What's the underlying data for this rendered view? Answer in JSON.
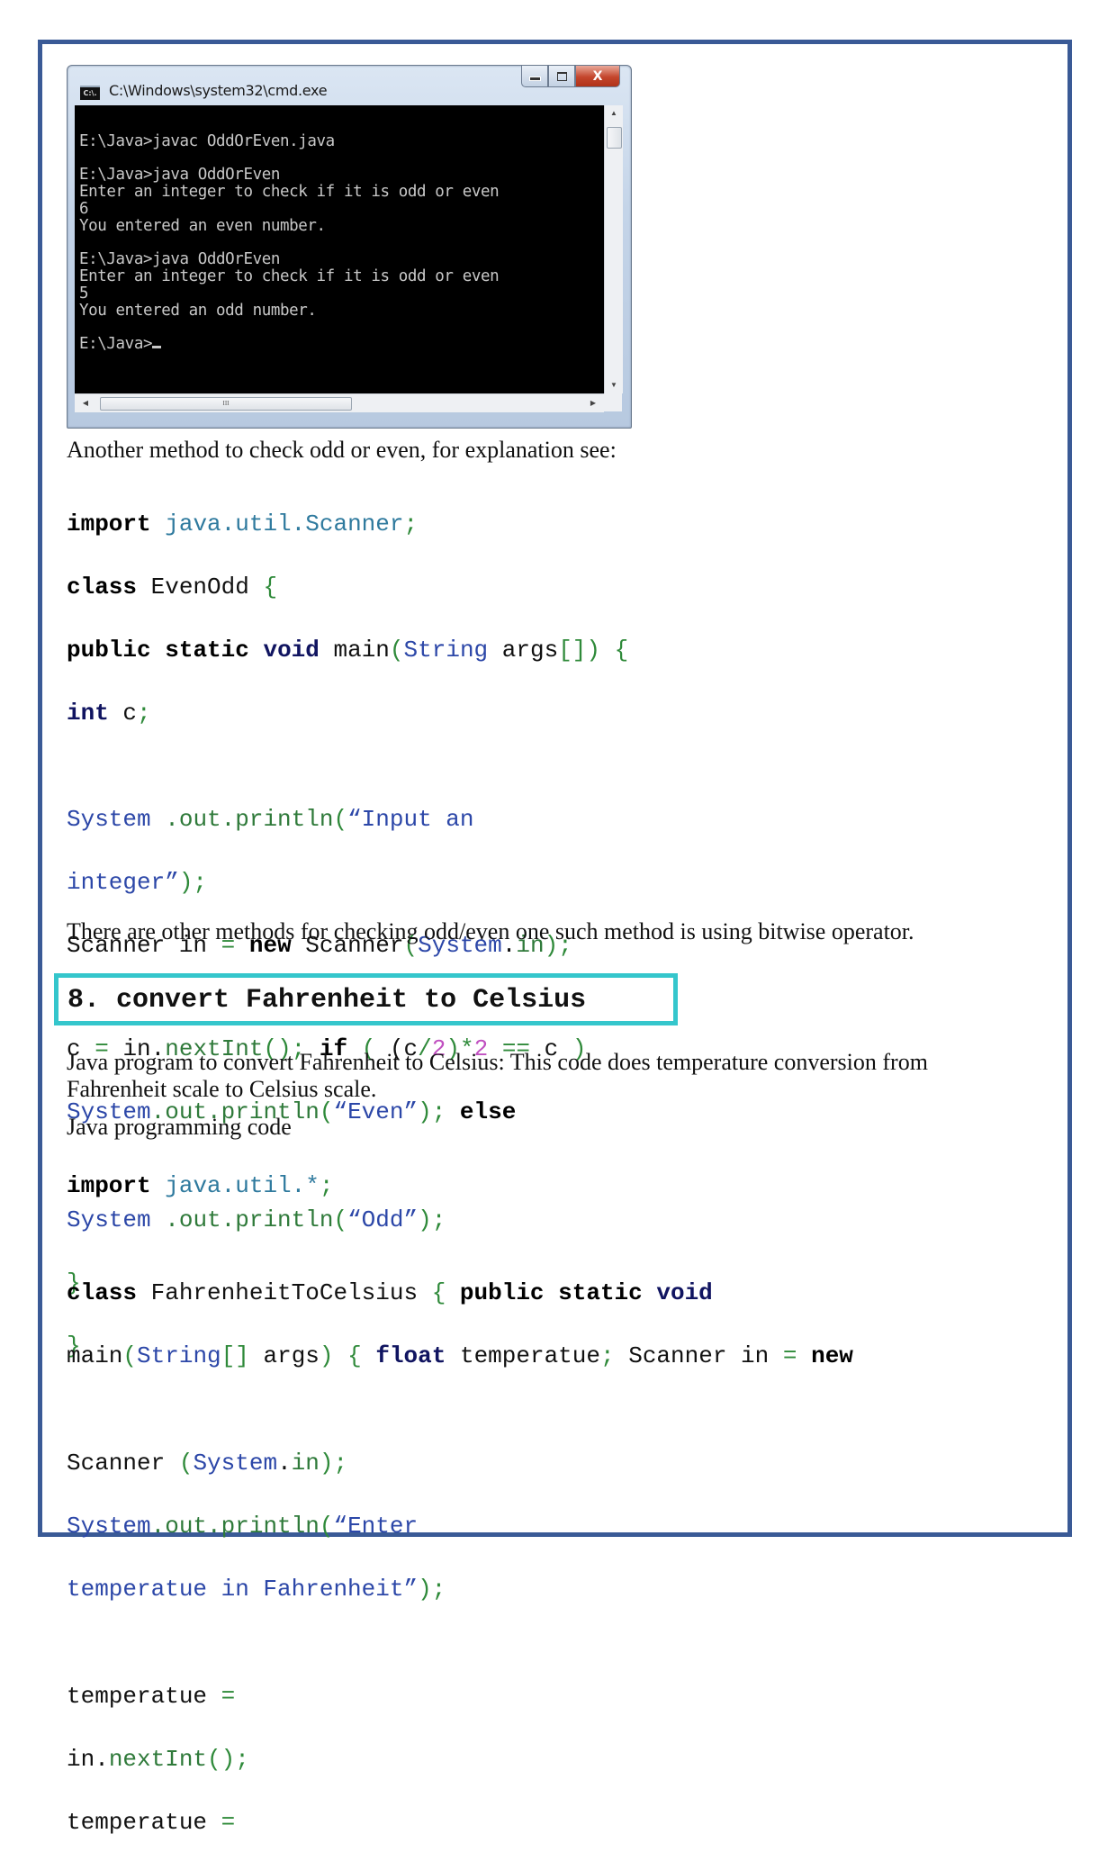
{
  "cmd_window": {
    "title": "C:\\Windows\\system32\\cmd.exe",
    "icon_label": "C:\\.",
    "buttons": {
      "minimize": "minimize",
      "maximize": "maximize",
      "close": "X"
    },
    "console_lines": [
      "",
      "E:\\Java>javac OddOrEven.java",
      "",
      "E:\\Java>java OddOrEven",
      "Enter an integer to check if it is odd or even",
      "6",
      "You entered an even number.",
      "",
      "E:\\Java>java OddOrEven",
      "Enter an integer to check if it is odd or even",
      "5",
      "You entered an odd number.",
      "",
      "E:\\Java>"
    ],
    "scrollbar_thumb_grip": "III"
  },
  "intro_text": "Another method to check odd or even, for explanation see:",
  "code1": {
    "l1": {
      "kw": "import",
      "pkg": "java.util.Scanner",
      "semi": ";"
    },
    "l2": {
      "kw": "class",
      "name": "EvenOdd",
      "brace": "{"
    },
    "l3": {
      "kw1": "public",
      "kw2": "static",
      "kw3": "void",
      "name": "main",
      "open": "(",
      "type": "String",
      "args": "args",
      "brackets": "[])",
      "brace": "{"
    },
    "l4": {
      "kw": "int",
      "var": "c",
      "semi": ";"
    },
    "l5": {
      "cls": "System",
      "dotout": ".out.println",
      "open": "(",
      "str": "“Input an"
    },
    "l6": {
      "str": "integer”",
      "close": ");"
    },
    "l7": {
      "type": "Scanner",
      "var": "in",
      "eq": "=",
      "kw": "new",
      "ctor": "Scanner",
      "open": "(",
      "cls": "System",
      "dot": ".",
      "field": "in",
      "close": ");"
    },
    "l8": {
      "var": "c",
      "eq": "=",
      "obj": "in.",
      "meth": "nextInt",
      "call": "();",
      "kw": "if",
      "open": "(",
      "p2": "(c",
      "slash": "/",
      "two": "2",
      "p3": ")*",
      "two2": "2",
      "eqeq": "==",
      "c": "c",
      "close": ")"
    },
    "l9": {
      "cls": "System",
      "dotout": ".out.println",
      "open": "(",
      "str": "“Even”",
      "close": ");",
      "kw": "else"
    },
    "l10": {
      "cls": "System",
      "dotout": ".out.println",
      "open": "(",
      "str": "“Odd”",
      "close": ");"
    },
    "l11": "}",
    "l12": "}"
  },
  "other_methods_text": "There are other methods for checking odd/even one such method is using bitwise operator.",
  "section": {
    "title": "8. convert Fahrenheit to Celsius"
  },
  "f2c_description": "Java program to convert Fahrenheit to Celsius: This code does temperature conversion from Fahrenheit scale to Celsius scale.",
  "code_label": "Java programming code",
  "code2": {
    "l1": {
      "kw": "import",
      "pkg": "java.util.*",
      "semi": ";"
    },
    "l2": {
      "kw": "class",
      "name": "FahrenheitToCelsius",
      "brace": "{",
      "kw1": "public",
      "kw2": "static",
      "kw3": "void"
    },
    "l3": {
      "name": "main",
      "open": "(",
      "type": "String",
      "brackets": "[]",
      "args": "args",
      "close": ")",
      "brace": "{",
      "kw": "float",
      "var": "temperatue",
      "semi": ";",
      "type2": "Scanner",
      "var2": "in",
      "eq": "=",
      "kw2": "new"
    },
    "l4": {
      "type": "Scanner",
      "open": "(",
      "cls": "System",
      "dot": ".",
      "field": "in",
      "close": ");"
    },
    "l5": {
      "cls": "System",
      "dotout": ".out.println",
      "open": "(",
      "str": "“Enter"
    },
    "l6": {
      "str": "temperatue in Fahrenheit”",
      "close": ");"
    },
    "l7": {
      "var": "temperatue",
      "eq": "="
    },
    "l8": {
      "obj": "in.",
      "meth": "nextInt",
      "call": "();"
    },
    "l9": {
      "var": "temperatue",
      "eq": "="
    }
  },
  "colors": {
    "page_border": "#3a5a96",
    "section_border": "#35c6cc",
    "keyword_blue": "#101460",
    "package_teal": "#2f7a9e",
    "punctuation_green": "#2f8a3a",
    "string_blue": "#2c47a8",
    "number_magenta": "#c050c0"
  }
}
